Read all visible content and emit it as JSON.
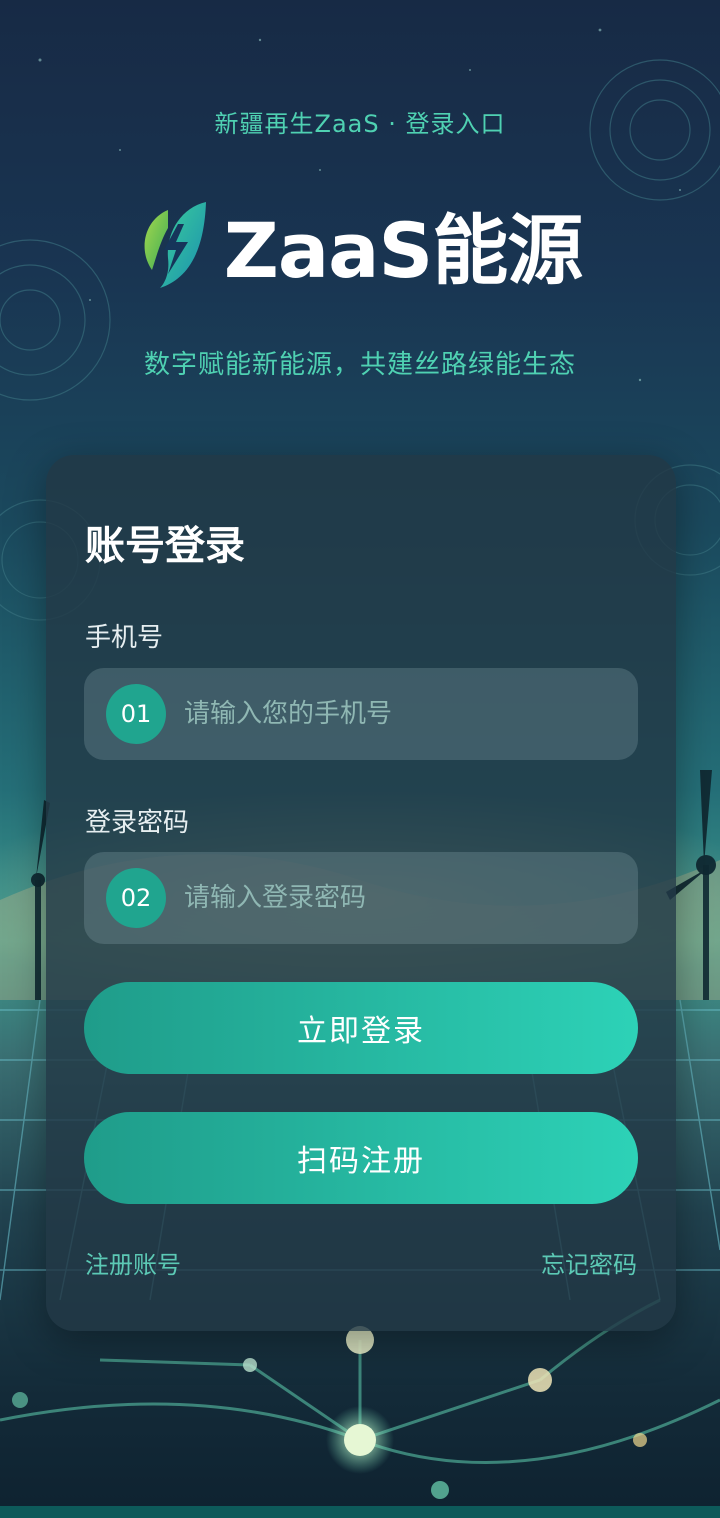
{
  "header": {
    "caption": "新疆再生ZaaS · 登录入口",
    "brand_name": "ZaaS能源",
    "logo_icon": "leaf-lightning-icon",
    "slogan": "数字赋能新能源，共建丝路绿能生态"
  },
  "login": {
    "title": "账号登录",
    "phone": {
      "label": "手机号",
      "badge": "01",
      "placeholder": "请输入您的手机号",
      "value": ""
    },
    "password": {
      "label": "登录密码",
      "badge": "02",
      "placeholder": "请输入登录密码",
      "value": ""
    },
    "login_button": "立即登录",
    "scan_register_button": "扫码注册",
    "register_link": "注册账号",
    "forgot_link": "忘记密码"
  },
  "colors": {
    "accent": "#2dd2b7",
    "accent_dark": "#1f9c8a",
    "caption_text": "#4fd1b2",
    "card_bg": "#223846",
    "background_top": "#172a45"
  }
}
